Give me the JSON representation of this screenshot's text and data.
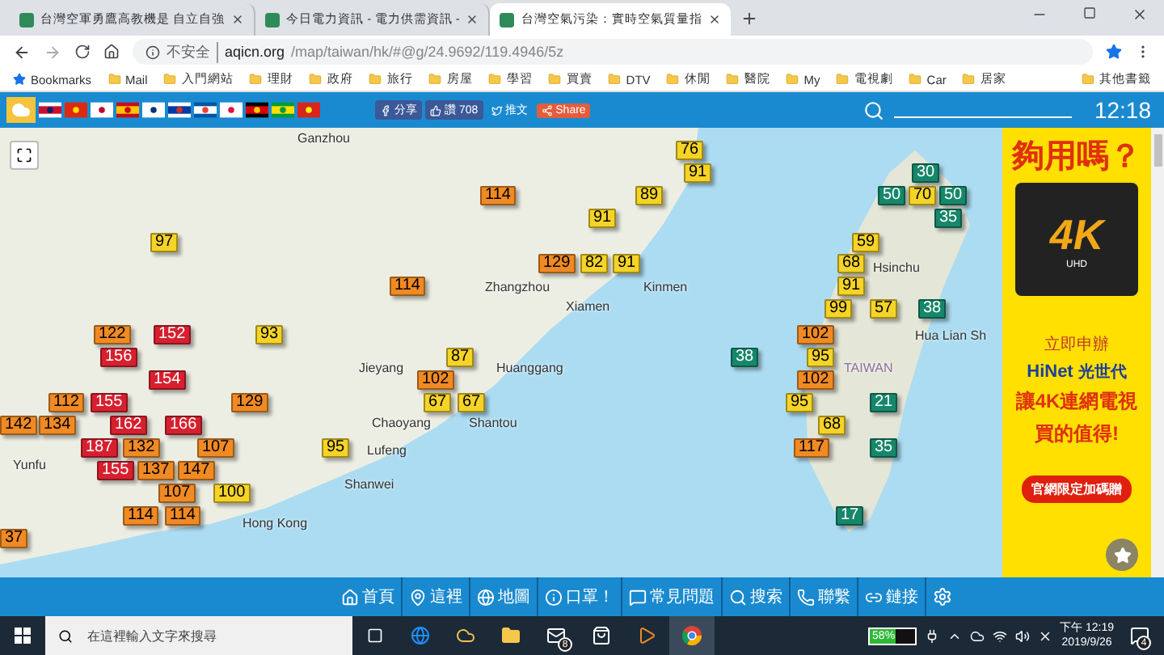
{
  "browser": {
    "tabs": [
      {
        "title": "台灣空軍勇鷹高教機是 自立自強",
        "selected": false
      },
      {
        "title": "今日電力資訊 - 電力供需資訊 -",
        "selected": false
      },
      {
        "title": "台灣空氣污染：實時空氣質量指",
        "selected": true
      }
    ],
    "security": "不安全",
    "url_host": "aqicn.org",
    "url_path": "/map/taiwan/hk/#@g/24.9692/119.4946/5z",
    "bookmarks": [
      "Bookmarks",
      "Mail",
      "入門網站",
      "理財",
      "政府",
      "旅行",
      "房屋",
      "學習",
      "買賣",
      "DTV",
      "休閒",
      "醫院",
      "My",
      "電視劇",
      "Car",
      "居家"
    ],
    "other_bookmarks": "其他書籤"
  },
  "site_bar": {
    "share": "分享",
    "like": "讚",
    "like_count": "708",
    "tweet": "推文",
    "share_button": "Share",
    "time": "12:18"
  },
  "markers": [
    {
      "value": "76",
      "color": "#f5d327"
    },
    {
      "value": "91",
      "color": "#f5d327"
    },
    {
      "value": "30",
      "color": "#16876a"
    },
    {
      "value": "114",
      "color": "#f08a24"
    },
    {
      "value": "89",
      "color": "#f5d327"
    },
    {
      "value": "50",
      "color": "#16876a"
    },
    {
      "value": "70",
      "color": "#f5d327"
    },
    {
      "value": "50",
      "color": "#16876a"
    },
    {
      "value": "91",
      "color": "#f5d327"
    },
    {
      "value": "35",
      "color": "#16876a"
    },
    {
      "value": "97",
      "color": "#f5d327"
    },
    {
      "value": "59",
      "color": "#f5d327"
    },
    {
      "value": "129",
      "color": "#f08a24"
    },
    {
      "value": "82",
      "color": "#f5d327"
    },
    {
      "value": "91",
      "color": "#f5d327"
    },
    {
      "value": "68",
      "color": "#f5d327"
    },
    {
      "value": "114",
      "color": "#f08a24"
    },
    {
      "value": "91",
      "color": "#f5d327"
    },
    {
      "value": "99",
      "color": "#f5d327"
    },
    {
      "value": "57",
      "color": "#f5d327"
    },
    {
      "value": "38",
      "color": "#16876a"
    },
    {
      "value": "122",
      "color": "#f08a24"
    },
    {
      "value": "152",
      "color": "#d7202f"
    },
    {
      "value": "93",
      "color": "#f5d327"
    },
    {
      "value": "102",
      "color": "#f08a24"
    },
    {
      "value": "156",
      "color": "#d7202f"
    },
    {
      "value": "87",
      "color": "#f5d327"
    },
    {
      "value": "38",
      "color": "#16876a"
    },
    {
      "value": "95",
      "color": "#f5d327"
    },
    {
      "value": "154",
      "color": "#d7202f"
    },
    {
      "value": "102",
      "color": "#f08a24"
    },
    {
      "value": "102",
      "color": "#f08a24"
    },
    {
      "value": "112",
      "color": "#f08a24"
    },
    {
      "value": "155",
      "color": "#d7202f"
    },
    {
      "value": "129",
      "color": "#f08a24"
    },
    {
      "value": "67",
      "color": "#f5d327"
    },
    {
      "value": "67",
      "color": "#f5d327"
    },
    {
      "value": "95",
      "color": "#f5d327"
    },
    {
      "value": "21",
      "color": "#16876a"
    },
    {
      "value": "142",
      "color": "#f08a24"
    },
    {
      "value": "134",
      "color": "#f08a24"
    },
    {
      "value": "162",
      "color": "#d7202f"
    },
    {
      "value": "166",
      "color": "#d7202f"
    },
    {
      "value": "68",
      "color": "#f5d327"
    },
    {
      "value": "187",
      "color": "#d7202f"
    },
    {
      "value": "132",
      "color": "#f08a24"
    },
    {
      "value": "107",
      "color": "#f08a24"
    },
    {
      "value": "95",
      "color": "#f5d327"
    },
    {
      "value": "117",
      "color": "#f08a24"
    },
    {
      "value": "35",
      "color": "#16876a"
    },
    {
      "value": "155",
      "color": "#d7202f"
    },
    {
      "value": "137",
      "color": "#f08a24"
    },
    {
      "value": "147",
      "color": "#f08a24"
    },
    {
      "value": "107",
      "color": "#f08a24"
    },
    {
      "value": "100",
      "color": "#f5d327"
    },
    {
      "value": "114",
      "color": "#f08a24"
    },
    {
      "value": "114",
      "color": "#f08a24"
    },
    {
      "value": "17",
      "color": "#16876a"
    },
    {
      "value": "37",
      "color": "#f08a24"
    }
  ],
  "places": [
    "Ganzhou",
    "Hsinchu",
    "Zhangzhou",
    "Kinmen",
    "Xiamen",
    "Hua Lian Sh",
    "Jieyang",
    "Huanggang",
    "TAIWAN",
    "Chaoyang",
    "Shantou",
    "Lufeng",
    "Yunfu",
    "Shanwei",
    "Hong Kong"
  ],
  "ad": {
    "headline": "夠用嗎？",
    "badge": "4K",
    "badge_sub": "UHD",
    "apply": "立即申辦",
    "brand": "HiNet",
    "brand_sub": "光世代",
    "slogan_1": "讓4K連網電視",
    "slogan_2": "買的值得!",
    "cta": "官網限定加碼贈"
  },
  "bottom_nav": [
    "首頁",
    "這裡",
    "地圖",
    "口罩！",
    "常見問題",
    "搜索",
    "聯繫",
    "鏈接"
  ],
  "taskbar": {
    "search_placeholder": "在這裡輸入文字來搜尋",
    "mail_badge": "8",
    "battery": "58%",
    "time": "下午 12:19",
    "date": "2019/9/26",
    "notifications": "4"
  }
}
